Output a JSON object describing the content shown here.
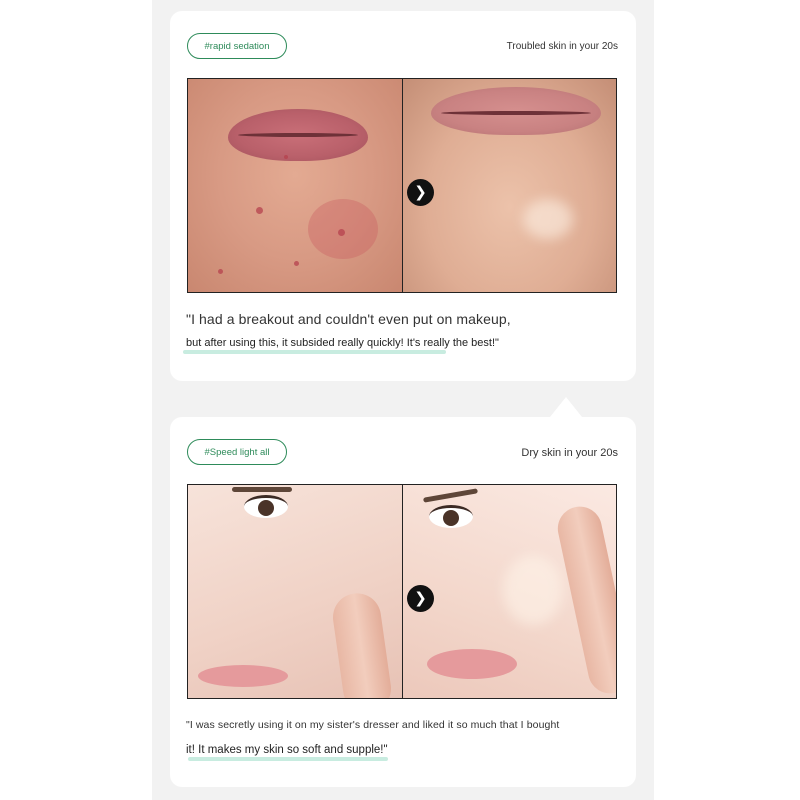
{
  "reviews": [
    {
      "tag": "#rapid sedation",
      "skin_type": "Troubled skin in your 20s",
      "quote_line1": "\"I had a breakout and couldn't even put on makeup,",
      "quote_line2": "but after using this, it subsided really quickly! It's really the best!\""
    },
    {
      "tag": "#Speed light all",
      "skin_type": "Dry skin in your 20s",
      "quote_line1": "\"I was secretly using it on my sister's dresser and liked it so much that I bought",
      "quote_line2": "it! It makes my skin so soft and supple!\""
    }
  ],
  "colors": {
    "accent": "#2e8b5a",
    "highlight": "#c8ece0",
    "background": "#f2f2f2",
    "card": "#ffffff"
  },
  "icons": {
    "next": "chevron-right-icon"
  }
}
